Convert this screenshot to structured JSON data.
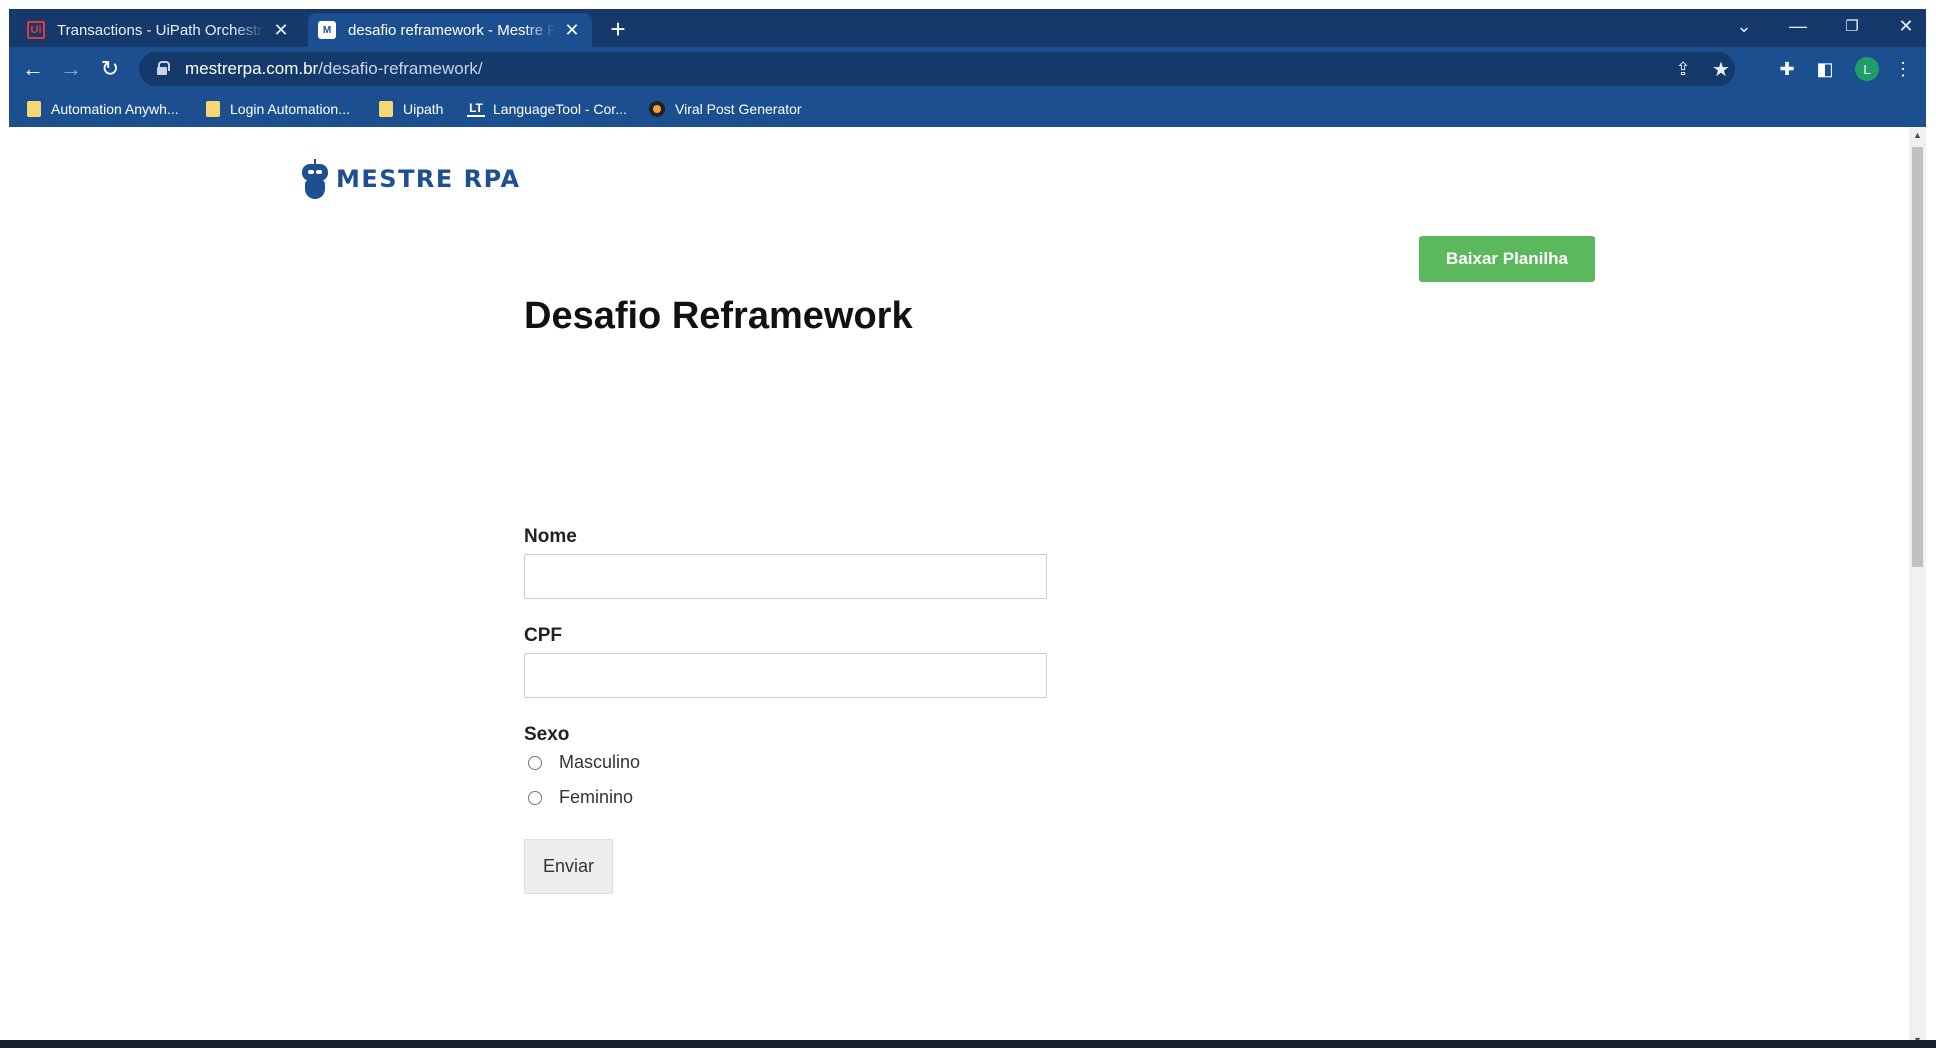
{
  "browser": {
    "tabs": [
      {
        "title": "Transactions - UiPath Orchestrator",
        "favicon": "Ui"
      },
      {
        "title": "desafio reframework - Mestre RPA",
        "favicon": "M"
      }
    ],
    "url_domain": "mestrerpa.com.br",
    "url_path": "/desafio-reframework/",
    "profile_initial": "L",
    "bookmarks": [
      {
        "label": "Automation Anywh...",
        "icon": "folder-icon"
      },
      {
        "label": "Login Automation...",
        "icon": "folder-icon"
      },
      {
        "label": "Uipath",
        "icon": "folder-icon"
      },
      {
        "label": "LanguageTool - Cor...",
        "icon": "languagetool-icon"
      },
      {
        "label": "Viral Post Generator",
        "icon": "viral-icon"
      }
    ]
  },
  "page": {
    "logo_text": "MESTRE RPA",
    "download_button": "Baixar Planilha",
    "title": "Desafio Reframework",
    "form": {
      "name_label": "Nome",
      "name_value": "",
      "cpf_label": "CPF",
      "cpf_value": "",
      "sex_label": "Sexo",
      "options": [
        "Masculino",
        "Feminino"
      ],
      "submit": "Enviar"
    }
  },
  "colors": {
    "chrome_dark": "#15396b",
    "chrome": "#1b4f90",
    "brand": "#1d4f91",
    "button_green": "#5cb85c"
  }
}
